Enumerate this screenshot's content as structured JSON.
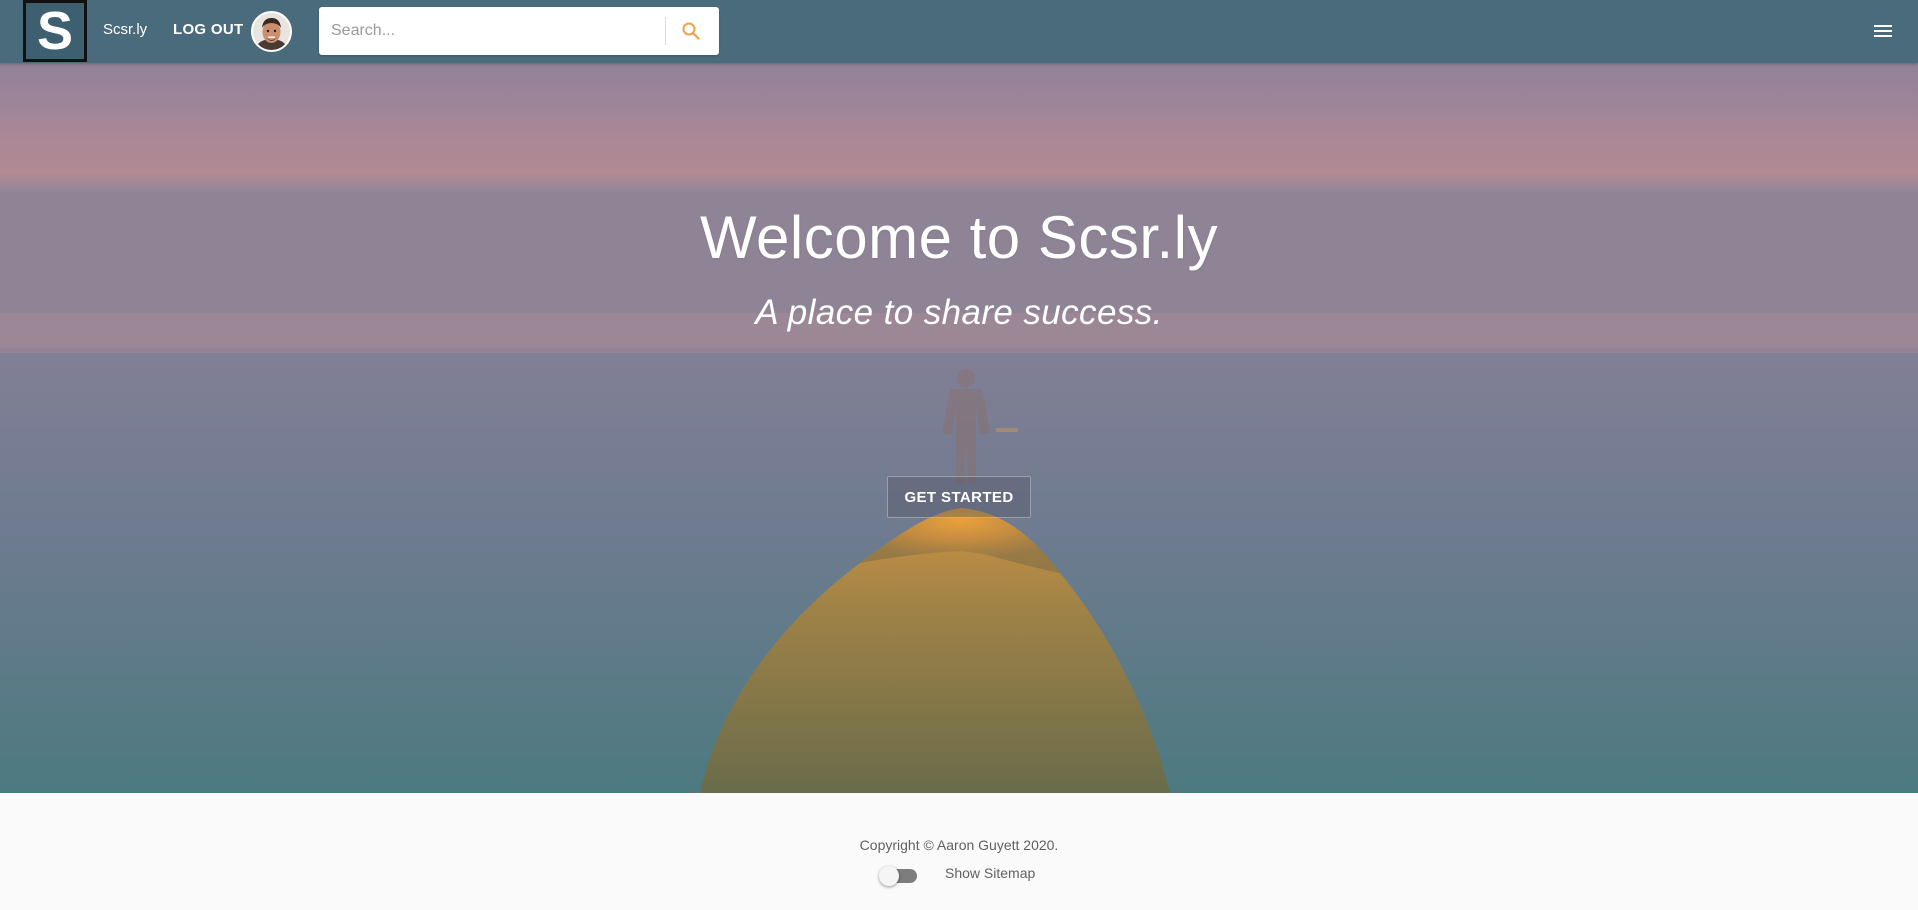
{
  "navbar": {
    "logo_letter": "S",
    "brand": "Scsr.ly",
    "logout": "LOG OUT",
    "avatar": "user-avatar-photo",
    "search": {
      "placeholder": "Search...",
      "value": "",
      "icon": "search-icon",
      "icon_color": "#f0a04b"
    },
    "menu_icon": "hamburger-menu-icon",
    "background_color": "#4a6b7c"
  },
  "hero": {
    "title": "Welcome to Scsr.ly",
    "subtitle": "A place to share success.",
    "cta_label": "GET STARTED",
    "background": "person-standing-on-sea-cliff-photo"
  },
  "footer": {
    "copyright": "Copyright © Aaron Guyett 2020.",
    "sitemap_toggle": {
      "label": "Show Sitemap",
      "checked": false
    }
  }
}
